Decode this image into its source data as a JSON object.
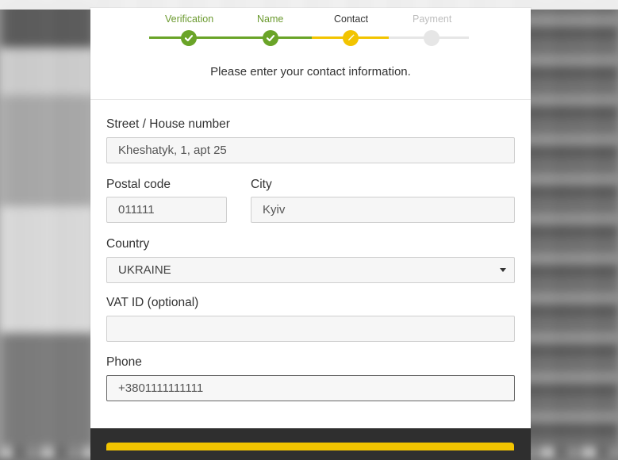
{
  "steps": [
    {
      "label": "Verification",
      "status": "done"
    },
    {
      "label": "Name",
      "status": "done"
    },
    {
      "label": "Contact",
      "status": "current"
    },
    {
      "label": "Payment",
      "status": "pending"
    }
  ],
  "colors": {
    "done": "#6aa428",
    "current": "#f2c400",
    "pending": "#e6e6e6",
    "text": "#333333"
  },
  "subtitle": "Please enter your contact information.",
  "form": {
    "street": {
      "label": "Street / House number",
      "value": "Kheshatyk, 1, apt 25"
    },
    "postal": {
      "label": "Postal code",
      "value": "011111"
    },
    "city": {
      "label": "City",
      "value": "Kyiv"
    },
    "country": {
      "label": "Country",
      "value": "UKRAINE"
    },
    "vat": {
      "label": "VAT ID (optional)",
      "value": ""
    },
    "phone": {
      "label": "Phone",
      "value": "+3801111111111"
    }
  }
}
